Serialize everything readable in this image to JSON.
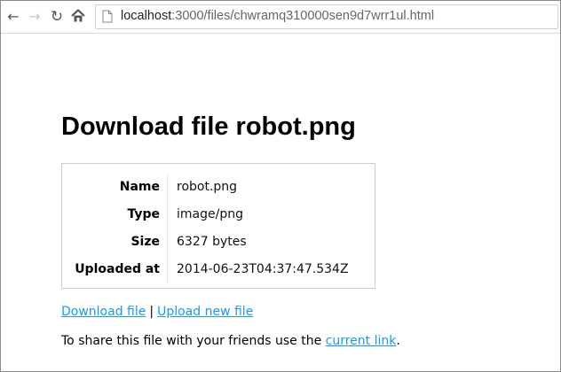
{
  "browser": {
    "back_icon": "back-arrow-icon",
    "forward_icon": "forward-arrow-icon",
    "reload_icon": "reload-icon",
    "home_icon": "home-icon",
    "url_host": "localhost",
    "url_path": ":3000/files/chwramq310000sen9d7wrr1ul.html"
  },
  "page": {
    "title": "Download file robot.png",
    "info": [
      {
        "label": "Name",
        "value": "robot.png"
      },
      {
        "label": "Type",
        "value": "image/png"
      },
      {
        "label": "Size",
        "value": "6327 bytes"
      },
      {
        "label": "Uploaded at",
        "value": "2014-06-23T04:37:47.534Z"
      }
    ],
    "links": {
      "download": "Download file",
      "separator": "|",
      "upload": "Upload new file"
    },
    "share": {
      "prefix": "To share this file with your friends use the ",
      "link": "current link",
      "suffix": "."
    }
  },
  "colors": {
    "link": "#1a9be6"
  }
}
